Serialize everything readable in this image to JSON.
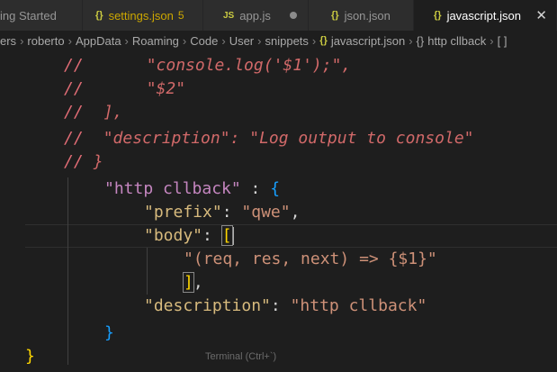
{
  "tabs": [
    {
      "label": "ing Started",
      "icon": "none",
      "active": false
    },
    {
      "label": "settings.json",
      "icon": "json-braces-icon",
      "badge": "5",
      "active": false
    },
    {
      "label": "app.js",
      "icon": "js-icon",
      "active": false,
      "dirty": true
    },
    {
      "label": "json.json",
      "icon": "json-braces-icon",
      "active": false
    },
    {
      "label": "javascript.json",
      "icon": "json-braces-icon",
      "active": true
    }
  ],
  "breadcrumbs": [
    "ers",
    "roberto",
    "AppData",
    "Roaming",
    "Code",
    "User",
    "snippets",
    "javascript.json",
    "http cllback",
    "[ ]"
  ],
  "code": {
    "l1": {
      "slash": "//",
      "text": "\"console.log('$1');\","
    },
    "l2": {
      "slash": "//",
      "text": "\"$2\""
    },
    "l3": {
      "slash": "//",
      "text": "],"
    },
    "l4": {
      "slash": "//",
      "text": "\"description\": \"Log output to console\""
    },
    "l5": {
      "slash": "//",
      "text": "}"
    },
    "l6": {
      "key": "\"http cllback\"",
      "sep": " : ",
      "brace": "{"
    },
    "l7": {
      "key": "\"prefix\"",
      "sep": ": ",
      "value": "\"qwe\"",
      "tail": ","
    },
    "l8": {
      "key": "\"body\"",
      "sep": ": ",
      "bracket": "["
    },
    "l9": {
      "value": "\"(req, res, next) => {$1}\""
    },
    "l10": {
      "bracket": "]",
      "tail": ","
    },
    "l11": {
      "key": "\"description\"",
      "sep": ": ",
      "value": "\"http cllback\""
    },
    "l12": {
      "brace": "}"
    },
    "l13": {
      "brace": "}"
    }
  },
  "hint": "Terminal (Ctrl+`)"
}
